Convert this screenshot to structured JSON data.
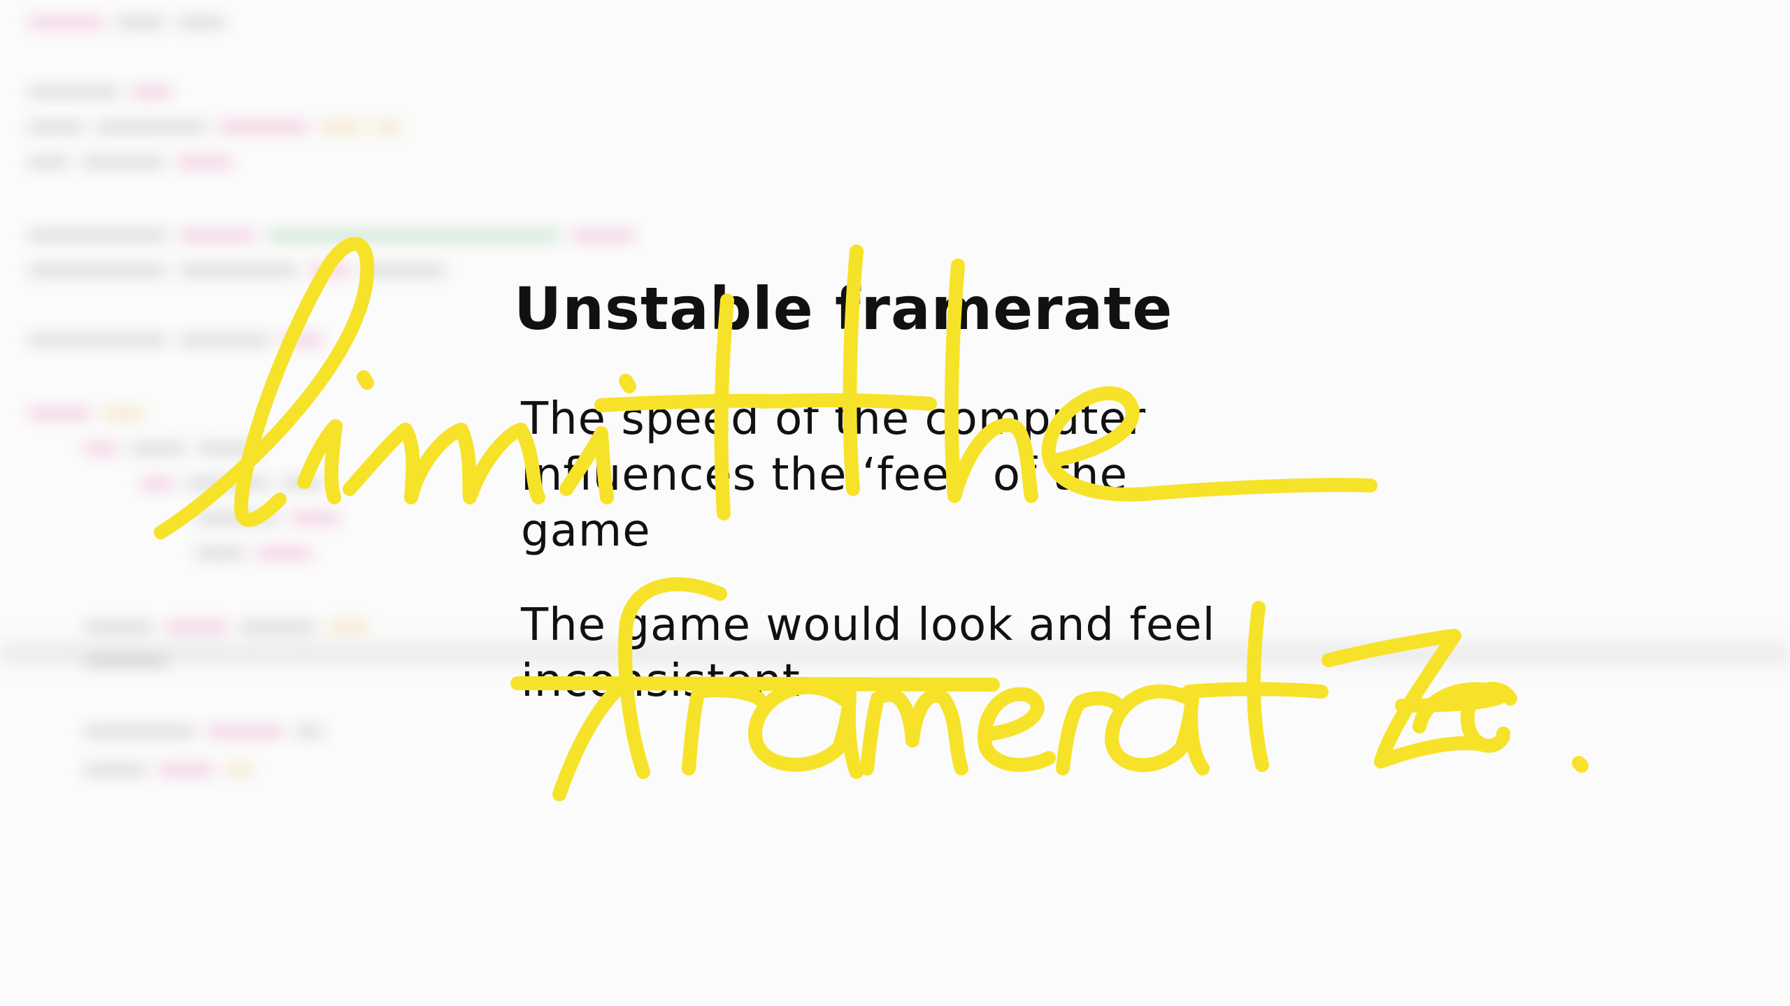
{
  "slide": {
    "title": "Unstable framerate",
    "paragraphs": [
      "The speed of the computer influences the ‘feel’ of the game",
      "The game would look and feel inconsistent"
    ]
  },
  "annotation": {
    "handwritten_text": "limit the framerate.",
    "ink_color": "#f7e22a"
  },
  "background": {
    "description_colors": {
      "keyword": "#d6338a",
      "string": "#2e9e3e",
      "number": "#e0a020",
      "plain": "#6b6b6b"
    }
  }
}
